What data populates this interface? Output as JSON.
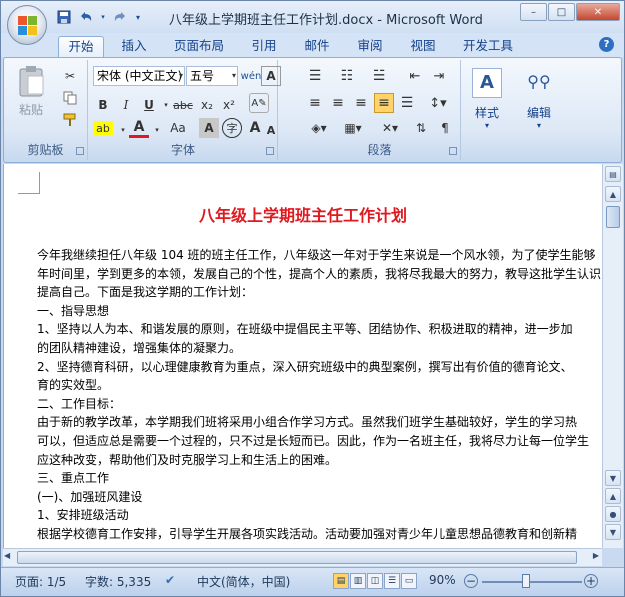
{
  "window": {
    "title": "八年级上学期班主任工作计划.docx - Microsoft Word",
    "controls": {
      "minimize": "–",
      "maximize": "□",
      "close": "✕"
    }
  },
  "quick_access": {
    "save_icon": "save-icon",
    "undo_icon": "undo-icon",
    "redo_icon": "redo-icon",
    "customize_icon": "customize-icon"
  },
  "tabs": [
    "开始",
    "插入",
    "页面布局",
    "引用",
    "邮件",
    "审阅",
    "视图",
    "开发工具"
  ],
  "active_tab": "开始",
  "ribbon": {
    "clipboard": {
      "label": "剪贴板",
      "paste": "粘贴"
    },
    "font": {
      "label": "字体",
      "font_name": "宋体 (中文正文)",
      "font_size": "五号",
      "phonetic": "wén",
      "bold": "B",
      "italic": "I",
      "underline": "U",
      "strike": "abc",
      "subscript": "x₂",
      "superscript": "x²",
      "font_color": "A",
      "change_case": "Aa",
      "char_shading": "A",
      "enclose": "字",
      "grow": "A",
      "shrink": "A",
      "highlight": "ab"
    },
    "paragraph": {
      "label": "段落"
    },
    "styles": {
      "label": "样式"
    },
    "editing": {
      "label": "编辑"
    }
  },
  "document": {
    "title": "八年级上学期班主任工作计划",
    "lines": [
      "今年我继续担任八年级 104 班的班主任工作，八年级这一年对于学生来说是一个风水领，为了使学生能够",
      "年时间里，学到更多的本领，发展自己的个性，提高个人的素质，我将尽我最大的努力，教导这批学生认识",
      "提高自己。下面是我这学期的工作计划：",
      "一、指导思想",
      "    1、坚持以人为本、和谐发展的原则，在班级中提倡民主平等、团结协作、积极进取的精神，进一步加",
      "的团队精神建设，增强集体的凝聚力。",
      "    2、坚持德育科研，以心理健康教育为重点，深入研究班级中的典型案例，撰写出有价值的德育论文、",
      "育的实效型。",
      "      二、工作目标：",
      "    由于新的教学改革，本学期我们班将采用小组合作学习方式。虽然我们班学生基础较好，学生的学习热",
      "可以，但适应总是需要一个过程的，只不过是长短而已。因此，作为一名班主任，我将尽力让每一位学生",
      "应这种改变，帮助他们及时克服学习上和生活上的困难。",
      "三、重点工作",
      "  (一)、加强班风建设",
      "  1、安排班级活动",
      "  根据学校德育工作安排，引导学生开展各项实践活动。活动要加强对青少年儿童思想品德教育和创新精"
    ]
  },
  "status_bar": {
    "page": "页面: 1/5",
    "words": "字数: 5,335",
    "language": "中文(简体，中国)",
    "zoom": "90%",
    "zoom_level_percent": 90
  },
  "colors": {
    "title_red": "#e0181f",
    "ribbon_blue": "#15428b",
    "accent": "#2f6fc0"
  }
}
